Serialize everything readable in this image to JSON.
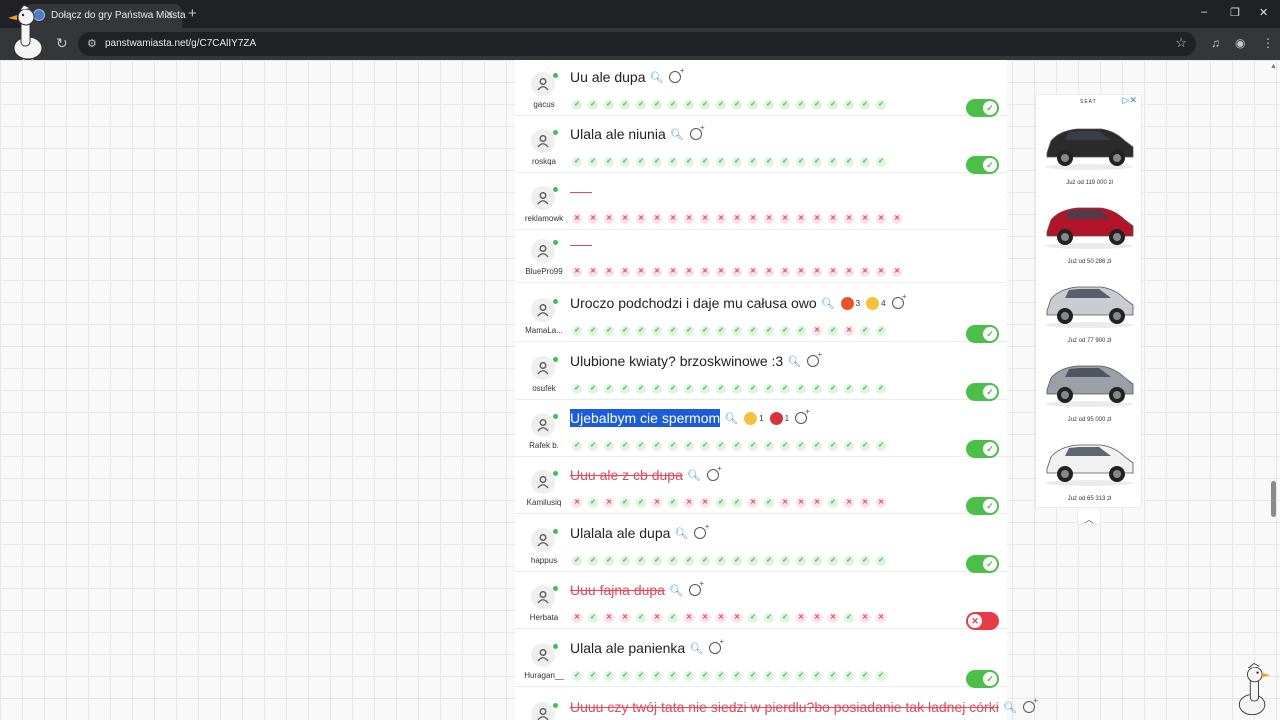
{
  "browser": {
    "tab_title": "Dołącz do gry Państwa Miasta",
    "tab_close": "✕",
    "new_tab": "+",
    "url": "panstwamiasta.net/g/C7CAlIY7ZA",
    "window_controls": {
      "minimize": "–",
      "restore": "❐",
      "close": "✕"
    },
    "icons": [
      "reload-icon",
      "tune-icon",
      "star-icon",
      "media-icon",
      "profile-icon",
      "menu-icon"
    ]
  },
  "rows": [
    {
      "user": "gacus",
      "answer": "Uu ale dupa",
      "status": "ok",
      "marks": "oooooooooooooooooooo",
      "toggle": "on",
      "reactions": []
    },
    {
      "user": "roskqa",
      "answer": "Ulala ale niunia",
      "status": "ok",
      "marks": "oooooooooooooooooooo",
      "toggle": "on",
      "reactions": []
    },
    {
      "user": "reklamowk",
      "answer": "",
      "status": "empty",
      "marks": "xxxxxxxxxxxxxxxxxxxxx",
      "toggle": "none",
      "reactions": []
    },
    {
      "user": "BluePro99",
      "answer": "",
      "status": "empty",
      "marks": "xxxxxxxxxxxxxxxxxxxxx",
      "toggle": "none",
      "reactions": []
    },
    {
      "user": "MamaLa...",
      "answer": "Uroczo podchodzi i daje mu całusa owo",
      "status": "ok",
      "marks": "oooooooooooooooxoxoo",
      "toggle": "on",
      "reactions": [
        {
          "emoji": "angry-face",
          "color": "#e8532c",
          "count": "3"
        },
        {
          "emoji": "laughing-face",
          "color": "#f6c23b",
          "count": "4"
        }
      ]
    },
    {
      "user": "osufek",
      "answer": "Ulubione kwiaty? brzoskwinowe :3",
      "status": "ok",
      "marks": "oooooooooooooooooooo",
      "toggle": "on",
      "reactions": []
    },
    {
      "user": "Rafek b.",
      "answer": "Ujebalbym cie spermom",
      "status": "selected",
      "marks": "oooooooooooooooooooo",
      "toggle": "on",
      "reactions": [
        {
          "emoji": "surprised-face",
          "color": "#f6c23b",
          "count": "1"
        },
        {
          "emoji": "heart",
          "color": "#d8323c",
          "count": "1"
        }
      ]
    },
    {
      "user": "Kamilusiq",
      "answer": "Uuu ale z cb dupa",
      "status": "rejected",
      "marks": "xoxooxoxxooxoxxxoxxx",
      "toggle": "on",
      "reactions": []
    },
    {
      "user": "happus",
      "answer": "Ulalala ale dupa",
      "status": "ok",
      "marks": "oooooooooooooooooooo",
      "toggle": "on",
      "reactions": []
    },
    {
      "user": "Herbata",
      "answer": "Uuu fajna dupa",
      "status": "rejected",
      "marks": "xoxxoxoxxxxoooxxxoxx",
      "toggle": "off",
      "reactions": []
    },
    {
      "user": "Huragan__",
      "answer": "Ulala ale panienka",
      "status": "ok",
      "marks": "oooooooooooooooooooo",
      "toggle": "on",
      "reactions": []
    },
    {
      "user": "",
      "answer": "Uuuu czy twój tata nie siedzi w pierdlu?bo posiadanie tak ładnej córki",
      "status": "rejected",
      "marks": "",
      "toggle": "none",
      "reactions": []
    }
  ],
  "ad": {
    "brand": "SEAT",
    "adchoices": "▷✕",
    "collapse": "︿",
    "cars": [
      {
        "price": "Już od 119 000 zł",
        "color": "#2b2b2b"
      },
      {
        "price": "Już od 50 286 zł",
        "color": "#b3142a"
      },
      {
        "price": "Już od 77 900 zł",
        "color": "#c9ccd0"
      },
      {
        "price": "Już od 95 000 zł",
        "color": "#9aa0a6"
      },
      {
        "price": "Już od 65 313 zł",
        "color": "#f1f1f1"
      }
    ]
  },
  "colors": {
    "accent_ok": "#4cbf49",
    "accent_bad": "#e2475a",
    "selection": "#1c5cd6"
  }
}
